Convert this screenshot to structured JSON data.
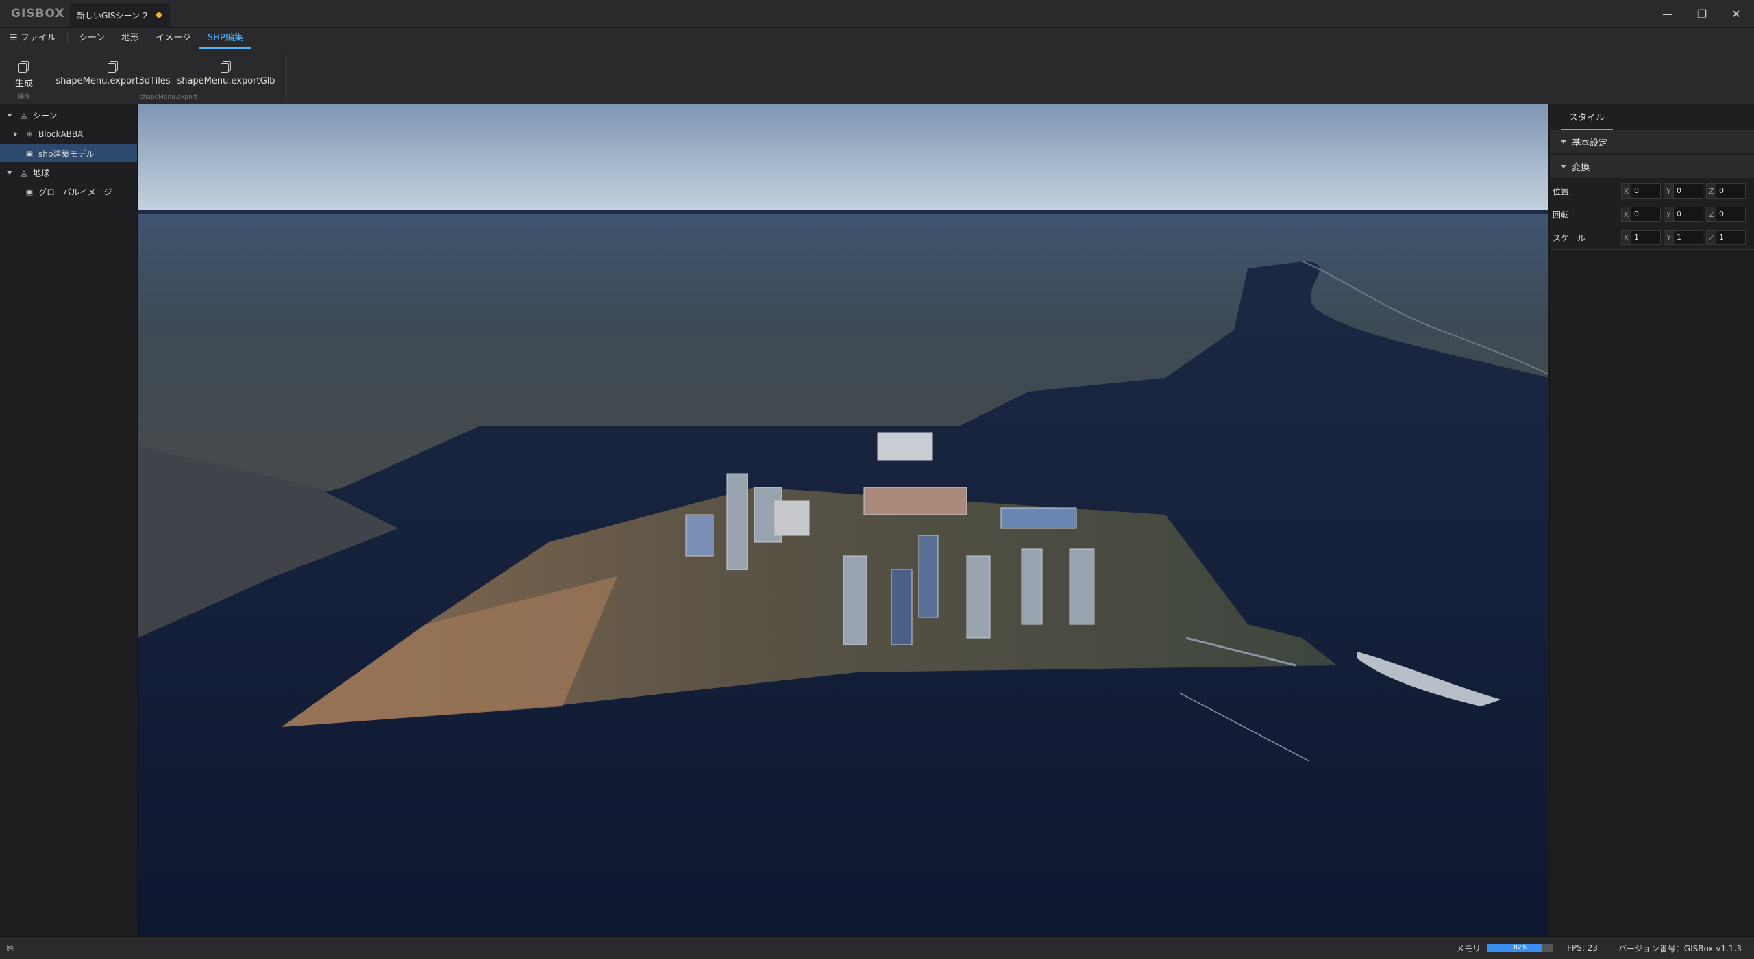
{
  "app": {
    "logo": "GISBOX",
    "document_tab": "新しいGISシーン-2",
    "window_controls": {
      "minimize": "—",
      "restore": "❐",
      "close": "✕"
    }
  },
  "menubar": {
    "file": "ファイル",
    "items": [
      "シーン",
      "地形",
      "イメージ",
      "SHP編集"
    ],
    "active": "SHP編集"
  },
  "ribbon": {
    "groups": [
      {
        "label": "操作",
        "buttons": [
          "生成"
        ]
      },
      {
        "label": "shapeMenu.export",
        "buttons": [
          "shapeMenu.export3dTiles",
          "shapeMenu.exportGlb"
        ]
      }
    ]
  },
  "tree": {
    "items": [
      {
        "label": "シーン",
        "level": 0,
        "expanded": true
      },
      {
        "label": "BlockABBA",
        "level": 1,
        "expanded": false
      },
      {
        "label": "shp建築モデル",
        "level": 1,
        "selected": true
      },
      {
        "label": "地球",
        "level": 0,
        "expanded": true
      },
      {
        "label": "グローバルイメージ",
        "level": 1
      }
    ]
  },
  "properties": {
    "tab": "スタイル",
    "sections": [
      "基本設定",
      "変換"
    ],
    "rows": [
      {
        "label": "位置",
        "x": "0",
        "y": "0",
        "z": "0"
      },
      {
        "label": "回転",
        "x": "0",
        "y": "0",
        "z": "0"
      },
      {
        "label": "スケール",
        "x": "1",
        "y": "1",
        "z": "1"
      }
    ],
    "axes": [
      "X",
      "Y",
      "Z"
    ]
  },
  "status": {
    "memory_label": "メモリ",
    "memory_percent": 82,
    "memory_text": "82%",
    "fps": "FPS: 23",
    "version": "バージョン番号：GISBox v1.1.3"
  },
  "colors": {
    "accent": "#4fb3ff",
    "selection": "#2d4a6e",
    "unsaved_dot": "#f0b429",
    "memory_fill": "#3b8ff0"
  }
}
